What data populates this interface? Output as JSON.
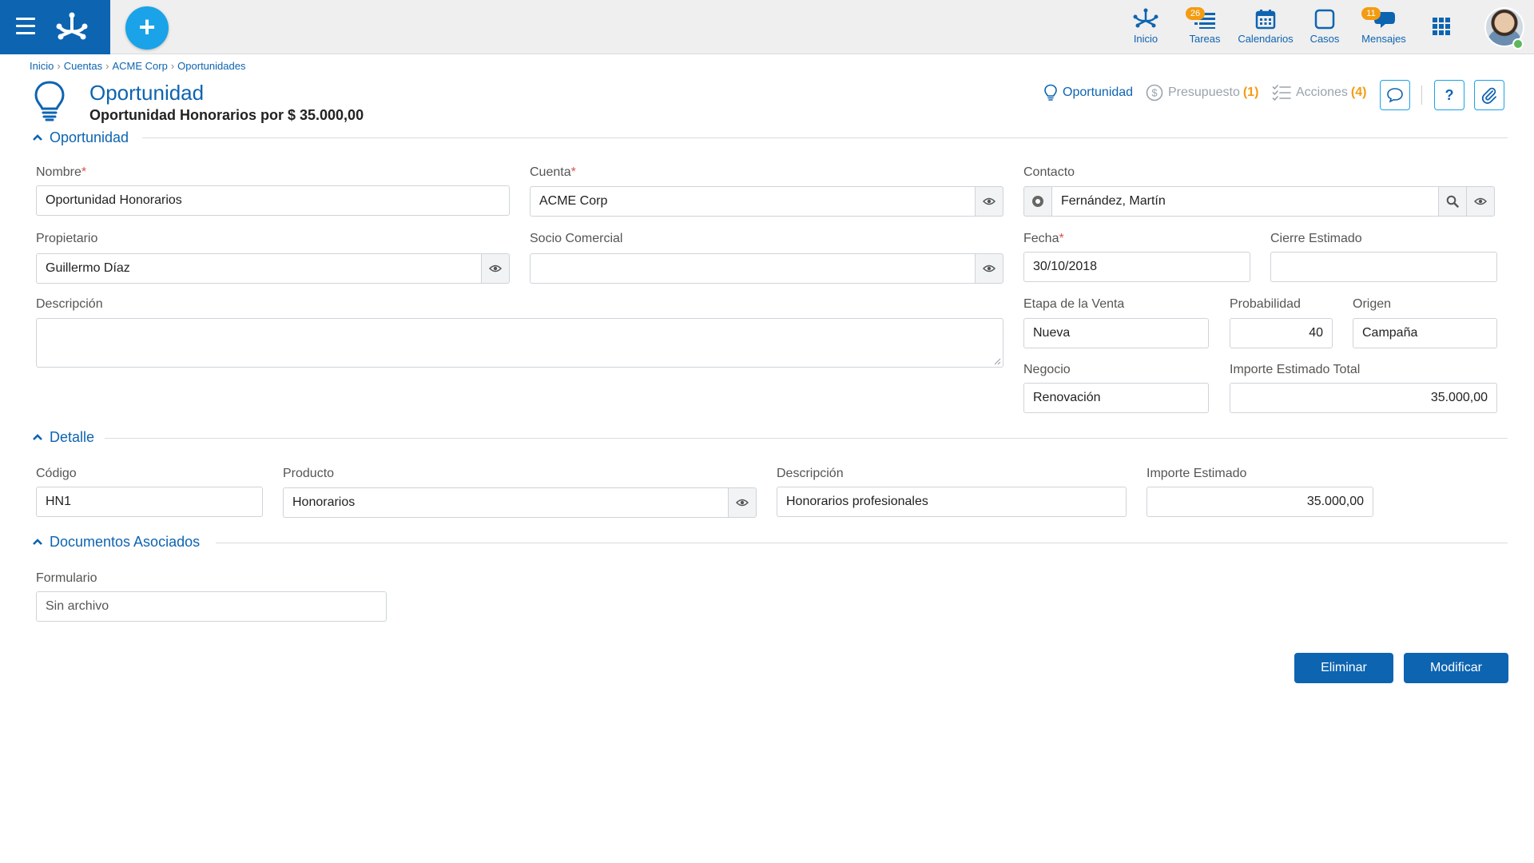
{
  "topbar": {
    "nav": [
      {
        "label": "Inicio",
        "icon": "home-network-icon"
      },
      {
        "label": "Tareas",
        "icon": "tasks-icon",
        "badge": "26"
      },
      {
        "label": "Calendarios",
        "icon": "calendar-icon"
      },
      {
        "label": "Casos",
        "icon": "cases-icon"
      },
      {
        "label": "Mensajes",
        "icon": "messages-icon",
        "badge": "11"
      }
    ]
  },
  "breadcrumb": [
    "Inicio",
    "Cuentas",
    "ACME Corp",
    "Oportunidades"
  ],
  "header": {
    "title": "Oportunidad",
    "subtitle": "Oportunidad Honorarios por $ 35.000,00",
    "links": {
      "oportunidad": "Oportunidad",
      "presupuesto": "Presupuesto",
      "presupuesto_count": "(1)",
      "acciones": "Acciones",
      "acciones_count": "(4)"
    },
    "help_label": "?"
  },
  "sections": {
    "oportunidad": "Oportunidad",
    "detalle": "Detalle",
    "documentos": "Documentos Asociados"
  },
  "form": {
    "nombre": {
      "label": "Nombre",
      "value": "Oportunidad Honorarios"
    },
    "cuenta": {
      "label": "Cuenta",
      "value": "ACME Corp"
    },
    "contacto": {
      "label": "Contacto",
      "value": "Fernández, Martín"
    },
    "propietario": {
      "label": "Propietario",
      "value": "Guillermo Díaz"
    },
    "socio": {
      "label": "Socio Comercial",
      "value": ""
    },
    "fecha": {
      "label": "Fecha",
      "value": "30/10/2018"
    },
    "cierre": {
      "label": "Cierre Estimado",
      "value": ""
    },
    "descripcion": {
      "label": "Descripción",
      "value": ""
    },
    "etapa": {
      "label": "Etapa de la Venta",
      "value": "Nueva"
    },
    "probabilidad": {
      "label": "Probabilidad",
      "value": "40"
    },
    "origen": {
      "label": "Origen",
      "value": "Campaña"
    },
    "negocio": {
      "label": "Negocio",
      "value": "Renovación"
    },
    "importe_total": {
      "label": "Importe Estimado Total",
      "value": "35.000,00"
    }
  },
  "detalle": {
    "codigo": {
      "label": "Código",
      "value": "HN1"
    },
    "producto": {
      "label": "Producto",
      "value": "Honorarios"
    },
    "descripcion": {
      "label": "Descripción",
      "value": "Honorarios profesionales"
    },
    "importe": {
      "label": "Importe Estimado",
      "value": "35.000,00"
    }
  },
  "documentos": {
    "formulario": {
      "label": "Formulario",
      "value": "Sin archivo"
    }
  },
  "actions": {
    "eliminar": "Eliminar",
    "modificar": "Modificar"
  },
  "colors": {
    "primary": "#0d64b1",
    "accent": "#1aa3e8",
    "badge": "#f39c12",
    "required": "#d9534f"
  }
}
